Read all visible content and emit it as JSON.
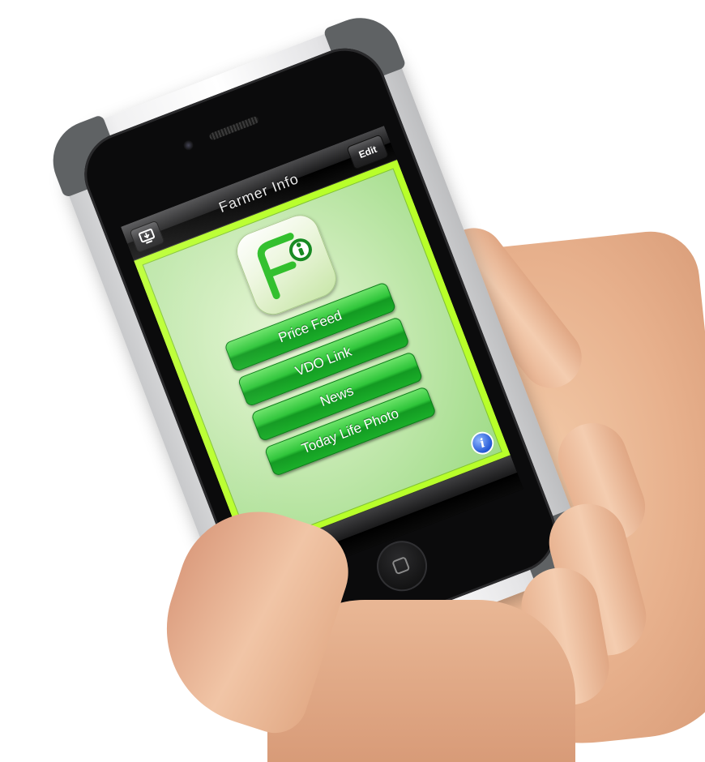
{
  "app": {
    "title": "Farmer Info",
    "edit_label": "Edit"
  },
  "menu": {
    "items": [
      {
        "label": "Price Feed"
      },
      {
        "label": "VDO Link"
      },
      {
        "label": "News"
      },
      {
        "label": "Today Life Photo"
      }
    ]
  },
  "info": {
    "glyph": "i"
  },
  "icons": {
    "export": "export-icon",
    "info": "info-icon",
    "refresh": "refresh-icon",
    "logo": "farmer-info-logo"
  },
  "colors": {
    "accent_green": "#2fc53a",
    "frame_green": "#b8ff2a",
    "info_blue": "#2458d6"
  }
}
